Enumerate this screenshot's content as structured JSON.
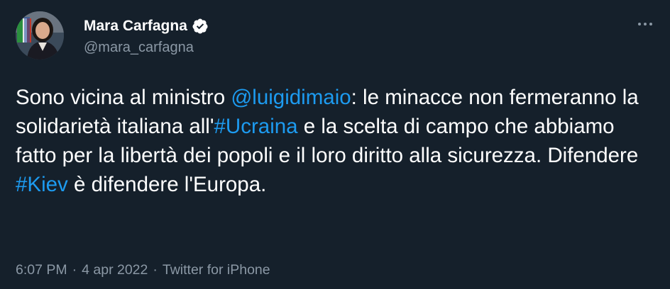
{
  "author": {
    "display_name": "Mara Carfagna",
    "handle": "@mara_carfagna",
    "verified_icon": "verified-badge-icon"
  },
  "tweet": {
    "segments": [
      {
        "text": "Sono vicina al ministro ",
        "type": "text"
      },
      {
        "text": "@luigidimaio",
        "type": "mention"
      },
      {
        "text": ": le minacce non fermeranno la solidarietà italiana all'",
        "type": "text"
      },
      {
        "text": "#Ucraina",
        "type": "hashtag"
      },
      {
        "text": " e la scelta di campo che abbiamo fatto per la libertà dei popoli e il loro diritto alla sicurezza. Difendere ",
        "type": "text"
      },
      {
        "text": "#Kiev",
        "type": "hashtag"
      },
      {
        "text": " è difendere l'Europa.",
        "type": "text"
      }
    ]
  },
  "meta": {
    "time": "6:07 PM",
    "separator": "·",
    "date": "4 apr 2022",
    "source": "Twitter for iPhone"
  },
  "menu": {
    "icon": "more-horizontal-icon"
  },
  "colors": {
    "background": "#15202b",
    "link": "#1d9bf0",
    "secondary_text": "#8b98a5",
    "primary_text": "#ffffff"
  }
}
